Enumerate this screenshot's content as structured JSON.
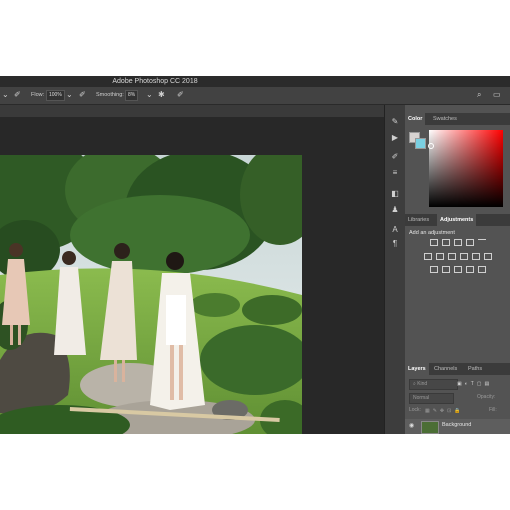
{
  "window": {
    "title": "Adobe Photoshop CC 2018"
  },
  "options_bar": {
    "flow_label": "Flow:",
    "flow_value": "100%",
    "smoothing_label": "Smoothing:",
    "smoothing_value": "8%"
  },
  "panels": {
    "color_tabs": [
      "Color",
      "Swatches"
    ],
    "adjust_tabs": [
      "Libraries",
      "Adjustments"
    ],
    "add_adjustment": "Add an adjustment",
    "layers_tabs": [
      "Layers",
      "Channels",
      "Paths"
    ],
    "layers": {
      "kind_label": "Kind",
      "blend_mode": "Normal",
      "opacity_label": "Opacity:",
      "lock_label": "Lock:",
      "fill_label": "Fill:",
      "layer_name": "Background"
    }
  },
  "colors": {
    "app_bg": "#535353",
    "title_bg": "#2b2b2b",
    "canvas_bg": "#282828",
    "foreground": "#d7d3d1",
    "background": "#7ad0e2",
    "hue_picker": "#ff0000"
  },
  "icons": {
    "tools": [
      "brush-tool-icon",
      "play-icon",
      "eyedropper-icon",
      "sliders-icon",
      "stack-icon",
      "person-icon",
      "text-icon",
      "paragraph-icon"
    ]
  }
}
